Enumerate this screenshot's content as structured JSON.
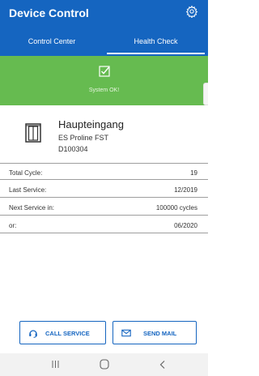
{
  "app": {
    "title": "Device Control",
    "settings_icon": "gear-icon",
    "accent_color": "#1565c0"
  },
  "tabs": [
    {
      "label": "Control Center",
      "active": false
    },
    {
      "label": "Health Check",
      "active": true
    }
  ],
  "status": {
    "icon": "checkbox-checked-icon",
    "text": "System OK!",
    "color": "#66bb50"
  },
  "device": {
    "icon": "revolving-door-icon",
    "name": "Haupteingang",
    "model": "ES Proline FST",
    "serial": "D100304"
  },
  "info_rows": [
    {
      "label": "Total Cycle:",
      "value": "19"
    },
    {
      "label": "Last Service:",
      "value": "12/2019"
    },
    {
      "label": "Next Service in:",
      "value": "100000 cycles"
    },
    {
      "label": "or:",
      "value": "06/2020"
    }
  ],
  "actions": {
    "call_label": "CALL SERVICE",
    "call_icon": "headset-icon",
    "mail_label": "SEND MAIL",
    "mail_icon": "envelope-icon"
  },
  "system_nav": {
    "recents_icon": "recents-icon",
    "home_icon": "home-icon",
    "back_icon": "back-icon"
  }
}
